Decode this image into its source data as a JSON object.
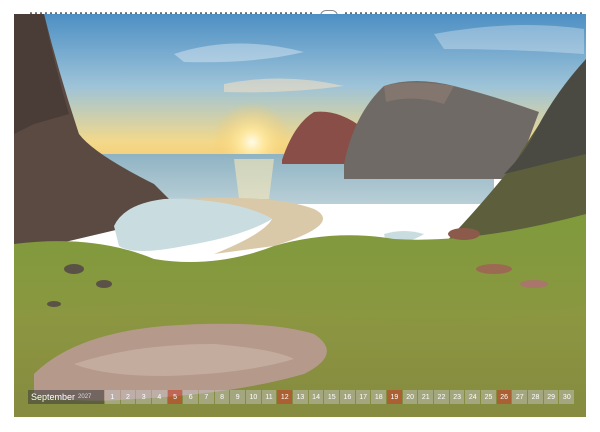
{
  "calendar": {
    "month": "September",
    "year": "2027",
    "days": [
      "1",
      "2",
      "3",
      "4",
      "5",
      "6",
      "7",
      "8",
      "9",
      "10",
      "11",
      "12",
      "13",
      "14",
      "15",
      "16",
      "17",
      "18",
      "19",
      "20",
      "21",
      "22",
      "23",
      "24",
      "25",
      "26",
      "27",
      "28",
      "29",
      "30"
    ],
    "sunday_indices": [
      4,
      11,
      18,
      25
    ],
    "colors": {
      "sunday": "#c83c28",
      "weekday": "#c8c8c8"
    }
  },
  "photo": {
    "subject": "coastal-bay-at-sunset"
  }
}
